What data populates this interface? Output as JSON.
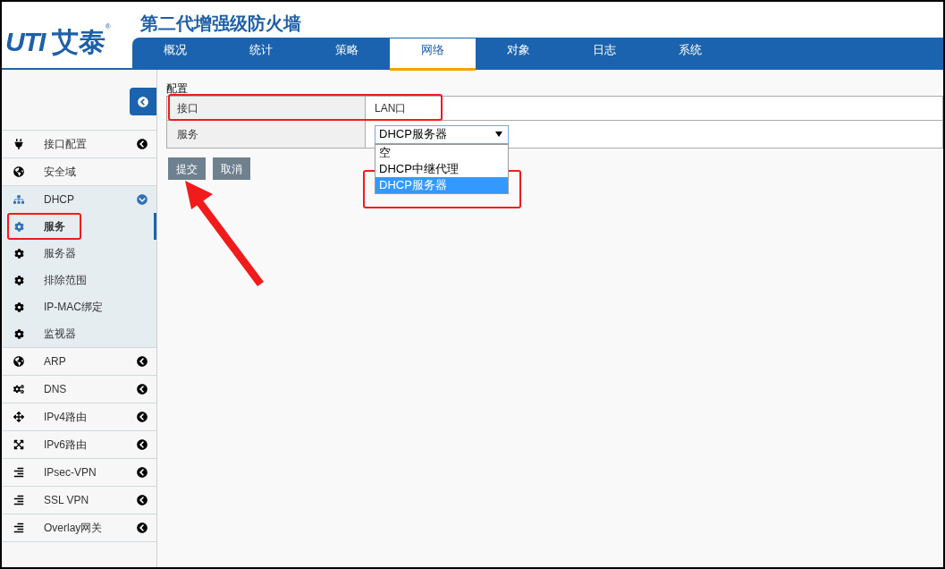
{
  "logo": {
    "mark": "UTI",
    "name": "艾泰",
    "registered": "®"
  },
  "product_title": "第二代增强级防火墙",
  "nav_tabs": [
    {
      "label": "概况",
      "selected": false
    },
    {
      "label": "统计",
      "selected": false
    },
    {
      "label": "策略",
      "selected": false
    },
    {
      "label": "网络",
      "selected": true
    },
    {
      "label": "对象",
      "selected": false
    },
    {
      "label": "日志",
      "selected": false
    },
    {
      "label": "系统",
      "selected": false
    }
  ],
  "sidebar": {
    "items": [
      {
        "label": "接口配置",
        "kind": "group",
        "expanded": false
      },
      {
        "label": "安全域",
        "kind": "link"
      },
      {
        "label": "DHCP",
        "kind": "group",
        "expanded": true,
        "children": [
          {
            "label": "服务",
            "selected": true
          },
          {
            "label": "服务器",
            "selected": false
          },
          {
            "label": "排除范围",
            "selected": false
          },
          {
            "label": "IP-MAC绑定",
            "selected": false
          },
          {
            "label": "监视器",
            "selected": false
          }
        ]
      },
      {
        "label": "ARP",
        "kind": "group",
        "expanded": false
      },
      {
        "label": "DNS",
        "kind": "group",
        "expanded": false
      },
      {
        "label": "IPv4路由",
        "kind": "group",
        "expanded": false
      },
      {
        "label": "IPv6路由",
        "kind": "group",
        "expanded": false
      },
      {
        "label": "IPsec-VPN",
        "kind": "group",
        "expanded": false
      },
      {
        "label": "SSL VPN",
        "kind": "group",
        "expanded": false
      },
      {
        "label": "Overlay网关",
        "kind": "group",
        "expanded": false
      }
    ]
  },
  "form": {
    "section_title": "配置",
    "rows": [
      {
        "label": "接口",
        "kind": "text",
        "value": "LAN口"
      },
      {
        "label": "服务",
        "kind": "select",
        "value": "DHCP服务器",
        "expanded": true,
        "options": [
          {
            "label": "空",
            "selected": false
          },
          {
            "label": "DHCP中继代理",
            "selected": false
          },
          {
            "label": "DHCP服务器",
            "selected": true
          }
        ]
      }
    ],
    "buttons": [
      "提交",
      "取消"
    ]
  }
}
